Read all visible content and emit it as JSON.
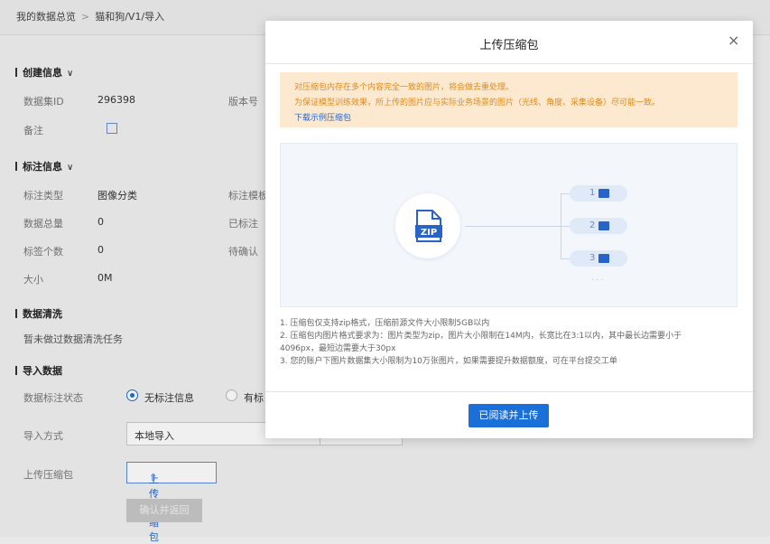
{
  "breadcrumb": {
    "root": "我的数据总览",
    "separator": ">",
    "current": "猫和狗/V1/导入"
  },
  "create_info": {
    "title": "创建信息",
    "dataset_id_label": "数据集ID",
    "dataset_id_value": "296398",
    "version_label": "版本号",
    "remark_label": "备注"
  },
  "annotation_info": {
    "title": "标注信息",
    "type_label": "标注类型",
    "type_value": "图像分类",
    "template_label": "标注模板",
    "total_label": "数据总量",
    "total_value": "0",
    "annotated_label": "已标注",
    "tag_count_label": "标签个数",
    "tag_count_value": "0",
    "pending_label": "待确认",
    "size_label": "大小",
    "size_value": "0M"
  },
  "cleaning": {
    "title": "数据清洗",
    "text": "暂未做过数据清洗任务"
  },
  "import": {
    "title": "导入数据",
    "status_label": "数据标注状态",
    "option_none": "无标注信息",
    "option_has": "有标",
    "method_label": "导入方式",
    "method_value": "本地导入",
    "upload_label": "上传压缩包",
    "upload_button": "上传压缩包",
    "confirm_button": "确认并返回"
  },
  "modal": {
    "title": "上传压缩包",
    "close": "×",
    "notice": [
      "对压缩包内存在多个内容完全一致的图片，将会做去重处理。",
      "为保证模型训练效果，所上传的图片应与实际业务场景的图片（光线、角度、采集设备）尽可能一致。"
    ],
    "sample_link": "下载示例压缩包",
    "diagram": {
      "zip_label": "ZIP",
      "items": [
        "1",
        "2",
        "3"
      ],
      "more": "···"
    },
    "rules": [
      "1. 压缩包仅支持zip格式，压缩前源文件大小限制5GB以内",
      "2. 压缩包内图片格式要求为：图片类型为zip，图片大小限制在14M内，长宽比在3:1以内，其中最长边需要小于",
      "4096px，最短边需要大于30px",
      "3. 您的账户下图片数据集大小限制为10万张图片，如果需要提升数据额度，可在平台提交工单"
    ],
    "primary_button": "已阅读并上传"
  },
  "colors": {
    "accent": "#1a6fd8",
    "notice_bg": "#fde9cf",
    "notice_text": "#e08a1a",
    "link": "#2a63c7"
  },
  "icons": [
    "chevron-down-icon",
    "edit-icon",
    "upload-icon",
    "close-icon",
    "zip-file-icon",
    "image-icon"
  ]
}
